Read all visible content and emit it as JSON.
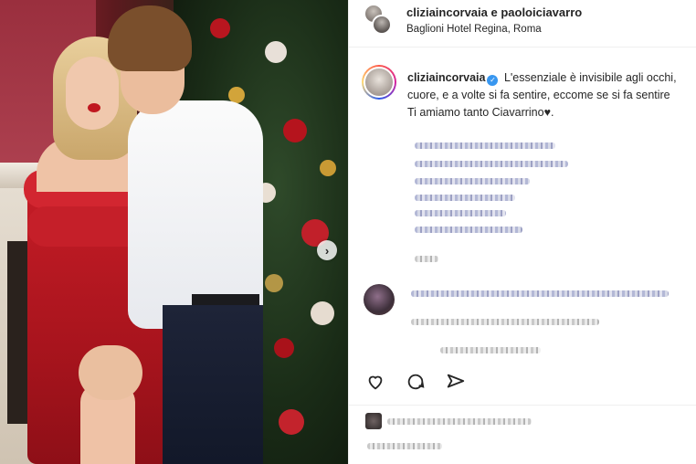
{
  "post": {
    "header": {
      "usernames": "cliziaincorvaia e paoloiciavarro",
      "location": "Baglioni Hotel Regina, Roma"
    },
    "caption": {
      "username": "cliziaincorvaia",
      "verified": true,
      "line1": "L'essenziale è invisibile agli occhi,",
      "line2": "cuore, e a volte si fa sentire, eccome se si fa sentire",
      "line3": "Ti amiamo tanto Ciavarrino♥."
    },
    "icons": [
      "carousel-next-icon",
      "heart-icon",
      "comment-icon",
      "share-icon"
    ],
    "colors": {
      "accent_blue": "#3897f0",
      "text": "#262626",
      "divider": "#efefef"
    }
  }
}
